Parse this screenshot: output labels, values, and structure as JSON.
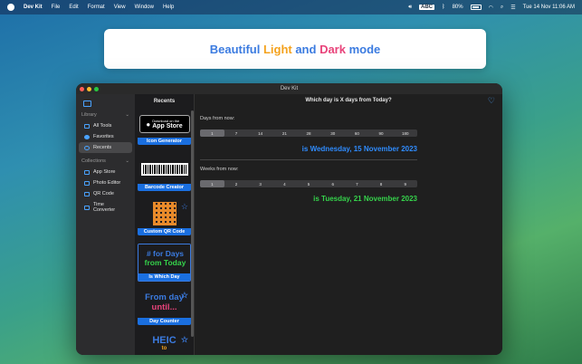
{
  "menubar": {
    "app_name": "Dev Kit",
    "menus": [
      "File",
      "Edit",
      "Format",
      "View",
      "Window",
      "Help"
    ],
    "input_source": "ABC",
    "battery": "80%",
    "clock": "Tue 14 Nov  11:06 AM"
  },
  "banner": {
    "part1": "Beautiful ",
    "part2": "Light",
    "part3": " and ",
    "part4": "Dark",
    "part5": " mode"
  },
  "window": {
    "title": "Dev Kit"
  },
  "sidebar": {
    "library_header": "Library",
    "library_items": [
      "All Tools",
      "Favorites",
      "Recents"
    ],
    "collections_header": "Collections",
    "collection_items": [
      "App Store",
      "Photo Editor",
      "QR Code",
      "Time Converter"
    ]
  },
  "recents": {
    "title": "Recents",
    "cards": [
      {
        "label": "Icon Generator",
        "badge_small": "Download on the",
        "badge_big": "App Store"
      },
      {
        "label": "Barcode Creator"
      },
      {
        "label": "Custom QR Code"
      },
      {
        "label": "Is Which Day",
        "line1": "# for Days",
        "line2": "from Today"
      },
      {
        "label": "Day Counter",
        "line1": "From day",
        "line2": "until..."
      },
      {
        "label": "",
        "line1": "HEIC",
        "line2": "to"
      }
    ]
  },
  "main": {
    "question": "Which day is X days from Today?",
    "days_label": "Days from now:",
    "days_options": [
      "1",
      "7",
      "14",
      "21",
      "28",
      "30",
      "60",
      "90",
      "180"
    ],
    "days_selected": "1",
    "days_result": "is Wednesday, 15 November 2023",
    "weeks_label": "Weeks from now:",
    "weeks_options": [
      "1",
      "2",
      "3",
      "4",
      "5",
      "6",
      "7",
      "8",
      "9"
    ],
    "weeks_selected": "1",
    "weeks_result": "is Tuesday, 21 November 2023"
  }
}
